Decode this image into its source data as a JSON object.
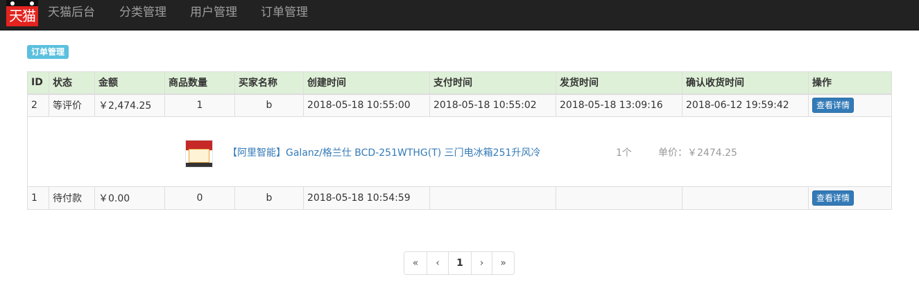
{
  "navbar": {
    "logo_text": "天猫",
    "items": [
      "天猫后台",
      "分类管理",
      "用户管理",
      "订单管理"
    ]
  },
  "section_badge": "订单管理",
  "table": {
    "headers": [
      "ID",
      "状态",
      "金额",
      "商品数量",
      "买家名称",
      "创建时间",
      "支付时间",
      "发货时间",
      "确认收货时间",
      "操作"
    ],
    "rows": [
      {
        "id": "2",
        "status": "等评价",
        "amount": "￥2,474.25",
        "quantity": "1",
        "buyer": "b",
        "created": "2018-05-18 10:55:00",
        "paid": "2018-05-18 10:55:02",
        "shipped": "2018-05-18 13:09:16",
        "confirmed": "2018-06-12 19:59:42",
        "action": "查看详情",
        "detail": {
          "product_name": "【阿里智能】Galanz/格兰仕 BCD-251WTHG(T) 三门电冰箱251升风冷",
          "quantity": "1个",
          "unit_price": "单价：￥2474.25"
        }
      },
      {
        "id": "1",
        "status": "待付款",
        "amount": "￥0.00",
        "quantity": "0",
        "buyer": "b",
        "created": "2018-05-18 10:54:59",
        "paid": "",
        "shipped": "",
        "confirmed": "",
        "action": "查看详情"
      }
    ]
  },
  "pagination": {
    "first": "«",
    "prev": "‹",
    "current": "1",
    "next": "›",
    "last": "»"
  }
}
